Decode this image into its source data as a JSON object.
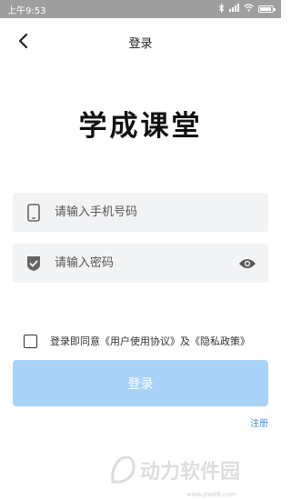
{
  "status_bar": {
    "time": "上午9:53",
    "icons": [
      "bluetooth-icon",
      "signal-icon",
      "wifi-icon",
      "battery-icon"
    ]
  },
  "nav": {
    "title": "登录",
    "back_icon": "back-arrow-icon"
  },
  "app_title": "学成课堂",
  "phone_field": {
    "placeholder": "请输入手机号码",
    "value": "",
    "icon": "phone-icon"
  },
  "password_field": {
    "placeholder": "请输入密码",
    "value": "",
    "icon": "shield-check-icon",
    "toggle_icon": "eye-icon"
  },
  "agreement": {
    "checked": false,
    "prefix": "登录即同意",
    "user_agreement": "《用户使用协议》",
    "and": "及",
    "privacy_policy": "《隐私政策》"
  },
  "login_button": {
    "label": "登录",
    "color": "#a8d3f7"
  },
  "register_link": {
    "label": "注册",
    "color": "#3b8fe6"
  },
  "watermark": {
    "text": "动力软件园",
    "url": "www.pw88.com"
  }
}
